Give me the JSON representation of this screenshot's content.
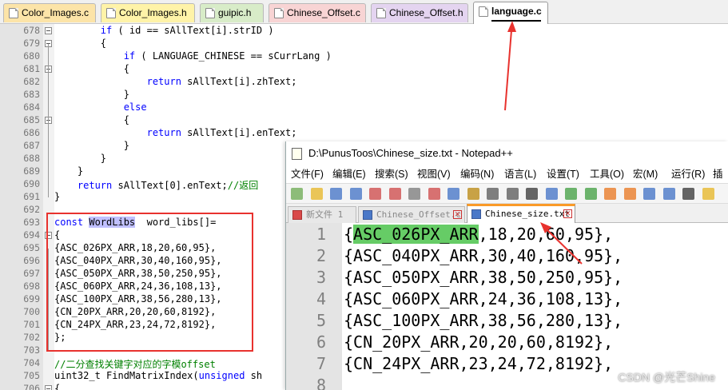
{
  "tabs": [
    {
      "label": "Color_Images.c",
      "color": "#fce4a8"
    },
    {
      "label": "Color_Images.h",
      "color": "#fff3a8"
    },
    {
      "label": "guipic.h",
      "color": "#d8ecc8"
    },
    {
      "label": "Chinese_Offset.c",
      "color": "#f8d4d4"
    },
    {
      "label": "Chinese_Offset.h",
      "color": "#e4d4f0"
    },
    {
      "label": "language.c",
      "color": "#ffffff",
      "active": true
    }
  ],
  "editor": {
    "lines": [
      {
        "n": "678",
        "segs": [
          [
            "        ",
            ""
          ],
          [
            "if",
            "kw"
          ],
          [
            " ( id == sAllText[i].strID )",
            ""
          ]
        ]
      },
      {
        "n": "679",
        "segs": [
          [
            "        {",
            ""
          ]
        ]
      },
      {
        "n": "680",
        "segs": [
          [
            "            ",
            ""
          ],
          [
            "if",
            "kw"
          ],
          [
            " ( LANGUAGE_CHINESE == sCurrLang )",
            ""
          ]
        ]
      },
      {
        "n": "681",
        "segs": [
          [
            "            {",
            ""
          ]
        ]
      },
      {
        "n": "682",
        "segs": [
          [
            "                ",
            ""
          ],
          [
            "return",
            "kw"
          ],
          [
            " sAllText[i].zhText;",
            ""
          ]
        ]
      },
      {
        "n": "683",
        "segs": [
          [
            "            }",
            ""
          ]
        ]
      },
      {
        "n": "684",
        "segs": [
          [
            "            ",
            ""
          ],
          [
            "else",
            "kw"
          ]
        ]
      },
      {
        "n": "685",
        "segs": [
          [
            "            {",
            ""
          ]
        ]
      },
      {
        "n": "686",
        "segs": [
          [
            "                ",
            ""
          ],
          [
            "return",
            "kw"
          ],
          [
            " sAllText[i].enText;",
            ""
          ]
        ]
      },
      {
        "n": "687",
        "segs": [
          [
            "            }",
            ""
          ]
        ]
      },
      {
        "n": "688",
        "segs": [
          [
            "        }",
            ""
          ]
        ]
      },
      {
        "n": "689",
        "segs": [
          [
            "    }",
            ""
          ]
        ]
      },
      {
        "n": "690",
        "segs": [
          [
            "    ",
            ""
          ],
          [
            "return",
            "kw"
          ],
          [
            " sAllText[0].enText;",
            ""
          ],
          [
            "//返回",
            "cm"
          ]
        ]
      },
      {
        "n": "691",
        "segs": [
          [
            "}",
            ""
          ]
        ]
      },
      {
        "n": "692",
        "segs": [
          [
            "",
            ""
          ]
        ]
      },
      {
        "n": "693",
        "segs": [
          [
            "const",
            "kw"
          ],
          [
            " ",
            ""
          ],
          [
            "WordLibs",
            "hl"
          ],
          [
            "  word_libs[]=",
            ""
          ]
        ]
      },
      {
        "n": "694",
        "segs": [
          [
            "{",
            ""
          ]
        ]
      },
      {
        "n": "695",
        "segs": [
          [
            "{ASC_026PX_ARR,18,20,60,95},",
            ""
          ]
        ]
      },
      {
        "n": "696",
        "segs": [
          [
            "{ASC_040PX_ARR,30,40,160,95},",
            ""
          ]
        ]
      },
      {
        "n": "697",
        "segs": [
          [
            "{ASC_050PX_ARR,38,50,250,95},",
            ""
          ]
        ]
      },
      {
        "n": "698",
        "segs": [
          [
            "{ASC_060PX_ARR,24,36,108,13},",
            ""
          ]
        ]
      },
      {
        "n": "699",
        "segs": [
          [
            "{ASC_100PX_ARR,38,56,280,13},",
            ""
          ]
        ]
      },
      {
        "n": "700",
        "segs": [
          [
            "{CN_20PX_ARR,20,20,60,8192},",
            ""
          ]
        ]
      },
      {
        "n": "701",
        "segs": [
          [
            "{CN_24PX_ARR,23,24,72,8192},",
            ""
          ]
        ]
      },
      {
        "n": "702",
        "segs": [
          [
            "};",
            ""
          ]
        ]
      },
      {
        "n": "703",
        "segs": [
          [
            "",
            ""
          ]
        ]
      },
      {
        "n": "704",
        "segs": [
          [
            "//二分查找关键字对应的字模offset",
            "cm"
          ]
        ]
      },
      {
        "n": "705",
        "segs": [
          [
            "uint32_t FindMatrixIndex(",
            ""
          ],
          [
            "unsigned",
            "kw"
          ],
          [
            " sh",
            ""
          ]
        ]
      },
      {
        "n": "706",
        "segs": [
          [
            "{",
            ""
          ]
        ]
      }
    ]
  },
  "notepad": {
    "title": "D:\\PunusToos\\Chinese_size.txt - Notepad++",
    "menu": [
      "文件(F)",
      "编辑(E)",
      "搜索(S)",
      "视图(V)",
      "编码(N)",
      "语言(L)",
      "设置(T)",
      "工具(O)",
      "宏(M)",
      "运行(R)",
      "插件"
    ],
    "tabs": [
      {
        "label": "新文件 1",
        "active": false
      },
      {
        "label": "Chinese_Offset.c",
        "active": false
      },
      {
        "label": "Chinese_size.txt",
        "active": true
      }
    ],
    "lines": [
      {
        "n": "1",
        "sel": "ASC_026PX_ARR",
        "pre": "{",
        "post": ",18,20,60,95},"
      },
      {
        "n": "2",
        "pre": "{ASC_040PX_ARR,30,40,160,95},"
      },
      {
        "n": "3",
        "pre": "{ASC_050PX_ARR,38,50,250,95},"
      },
      {
        "n": "4",
        "pre": "{ASC_060PX_ARR,24,36,108,13},"
      },
      {
        "n": "5",
        "pre": "{ASC_100PX_ARR,38,56,280,13},"
      },
      {
        "n": "6",
        "pre": "{CN_20PX_ARR,20,20,60,8192},"
      },
      {
        "n": "7",
        "pre": "{CN_24PX_ARR,23,24,72,8192},"
      },
      {
        "n": "8",
        "pre": ""
      }
    ]
  },
  "watermark": "CSDN @光芒Shine",
  "colors": {
    "annotation": "#e8322e",
    "selection": "#66cc66",
    "active_tab_accent": "#fa9a28"
  }
}
